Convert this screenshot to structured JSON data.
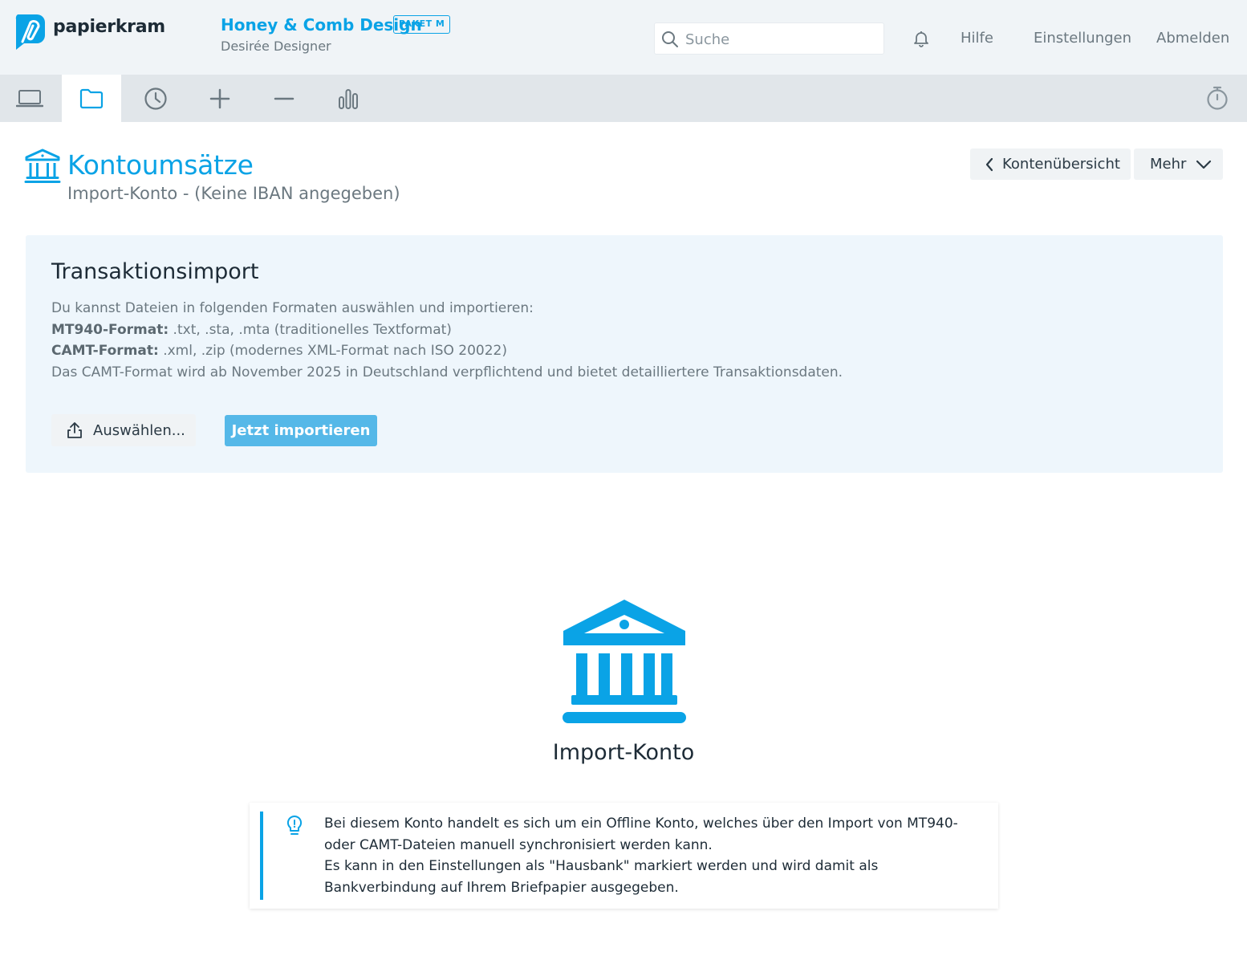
{
  "header": {
    "brand": "papierkram",
    "company": "Honey & Comb Design",
    "plan_badge": "PAKET M",
    "user": "Desirée Designer",
    "search_placeholder": "Suche",
    "nav": {
      "help": "Hilfe",
      "settings": "Einstellungen",
      "logout": "Abmelden"
    }
  },
  "toolbar": {
    "items": [
      "laptop-icon",
      "folder-icon",
      "clock-icon",
      "plus-icon",
      "minus-icon",
      "bar-chart-icon"
    ],
    "active": "folder-icon",
    "right": "stopwatch-icon"
  },
  "page": {
    "title": "Kontoumsätze",
    "subtitle": "Import-Konto - (Keine IBAN angegeben)",
    "back_label": "Kontenübersicht",
    "more_label": "Mehr"
  },
  "import_panel": {
    "title": "Transaktionsimport",
    "intro": "Du kannst Dateien in folgenden Formaten auswählen und importieren:",
    "mt940_label": "MT940-Format:",
    "mt940_text": " .txt, .sta, .mta (traditionelles Textformat)",
    "camt_label": "CAMT-Format:",
    "camt_text": " .xml, .zip (modernes XML-Format nach ISO 20022)",
    "note": "Das CAMT-Format wird ab November 2025 in Deutschland verpflichtend und bietet detailliertere Transaktionsdaten.",
    "select_label": "Auswählen...",
    "import_label": "Jetzt importieren"
  },
  "account": {
    "name": "Import-Konto"
  },
  "info": {
    "line1": "Bei diesem Konto handelt es sich um ein Offline Konto, welches über den Import von MT940- oder CAMT-Dateien manuell synchronisiert werden kann.",
    "line2": "Es kann in den Einstellungen als \"Hausbank\" markiert werden und wird damit als Bankverbindung auf Ihrem Briefpapier ausgegeben."
  },
  "colors": {
    "accent": "#0aa3e6",
    "import_button": "#55b8e8",
    "panel_bg": "#eef6fc"
  }
}
